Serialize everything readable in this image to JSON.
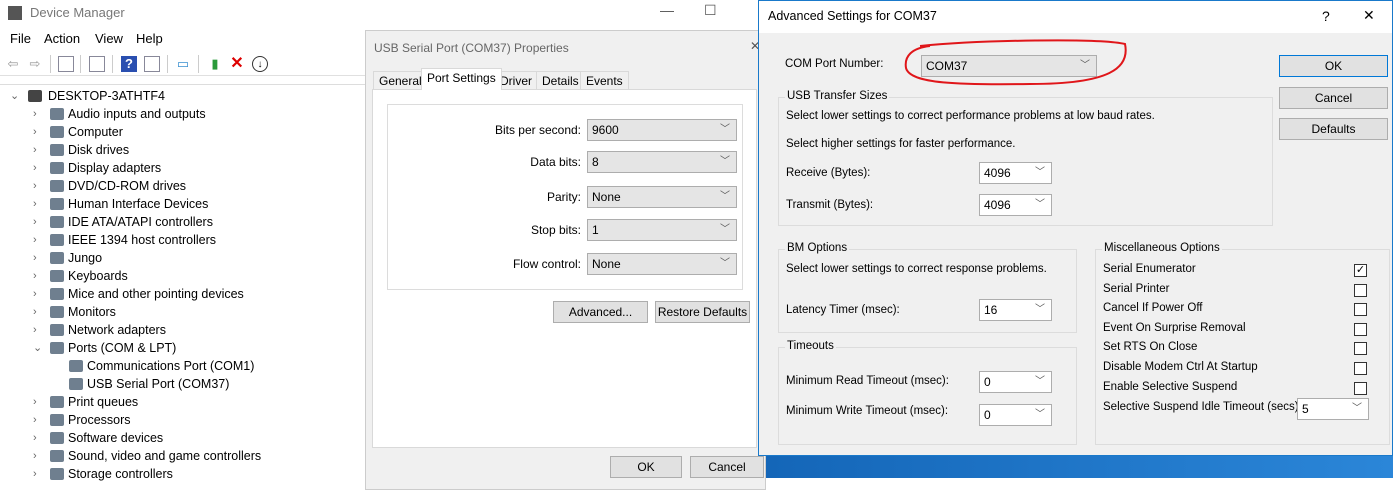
{
  "device_manager": {
    "title": "Device Manager",
    "menu": [
      "File",
      "Action",
      "View",
      "Help"
    ],
    "toolbar_icons": [
      "back-icon",
      "forward-icon",
      "console-tree-icon",
      "properties-icon",
      "help-icon",
      "action-pane-icon",
      "scan-hardware-icon",
      "update-driver-icon",
      "uninstall-icon",
      "disable-icon"
    ],
    "root": "DESKTOP-3ATHTF4",
    "categories": [
      "Audio inputs and outputs",
      "Computer",
      "Disk drives",
      "Display adapters",
      "DVD/CD-ROM drives",
      "Human Interface Devices",
      "IDE ATA/ATAPI controllers",
      "IEEE 1394 host controllers",
      "Jungo",
      "Keyboards",
      "Mice and other pointing devices",
      "Monitors",
      "Network adapters",
      "Ports (COM & LPT)",
      "Communications Port (COM1)",
      "USB Serial Port (COM37)",
      "Print queues",
      "Processors",
      "Software devices",
      "Sound, video and game controllers",
      "Storage controllers"
    ]
  },
  "properties": {
    "title": "USB Serial Port (COM37) Properties",
    "tabs": [
      "General",
      "Port Settings",
      "Driver",
      "Details",
      "Events"
    ],
    "active_tab": "Port Settings",
    "fields": [
      {
        "label": "Bits per second:",
        "value": "9600"
      },
      {
        "label": "Data bits:",
        "value": "8"
      },
      {
        "label": "Parity:",
        "value": "None"
      },
      {
        "label": "Stop bits:",
        "value": "1"
      },
      {
        "label": "Flow control:",
        "value": "None"
      }
    ],
    "advanced": "Advanced...",
    "restore": "Restore Defaults",
    "ok": "OK",
    "cancel": "Cancel"
  },
  "advanced": {
    "title": "Advanced Settings for COM37",
    "help": "?",
    "close": "✕",
    "com_label": "COM Port Number:",
    "com_value": "COM37",
    "ok": "OK",
    "cancel": "Cancel",
    "defaults": "Defaults",
    "usb": {
      "title": "USB Transfer Sizes",
      "desc1": "Select lower settings to correct performance problems at low baud rates.",
      "desc2": "Select higher settings for faster performance.",
      "receive_label": "Receive (Bytes):",
      "receive": "4096",
      "transmit_label": "Transmit (Bytes):",
      "transmit": "4096"
    },
    "bm": {
      "title": "BM Options",
      "desc": "Select lower settings to correct response problems.",
      "latency_label": "Latency Timer (msec):",
      "latency": "16"
    },
    "timeouts": {
      "title": "Timeouts",
      "read_label": "Minimum Read Timeout (msec):",
      "read": "0",
      "write_label": "Minimum Write Timeout (msec):",
      "write": "0"
    },
    "misc": {
      "title": "Miscellaneous Options",
      "options": [
        {
          "label": "Serial Enumerator",
          "checked": true
        },
        {
          "label": "Serial Printer",
          "checked": false
        },
        {
          "label": "Cancel If Power Off",
          "checked": false
        },
        {
          "label": "Event On Surprise Removal",
          "checked": false
        },
        {
          "label": "Set RTS On Close",
          "checked": false
        },
        {
          "label": "Disable Modem Ctrl At Startup",
          "checked": false
        },
        {
          "label": "Enable Selective Suspend",
          "checked": false
        }
      ],
      "suspend_label": "Selective Suspend Idle Timeout (secs):",
      "suspend": "5"
    }
  }
}
